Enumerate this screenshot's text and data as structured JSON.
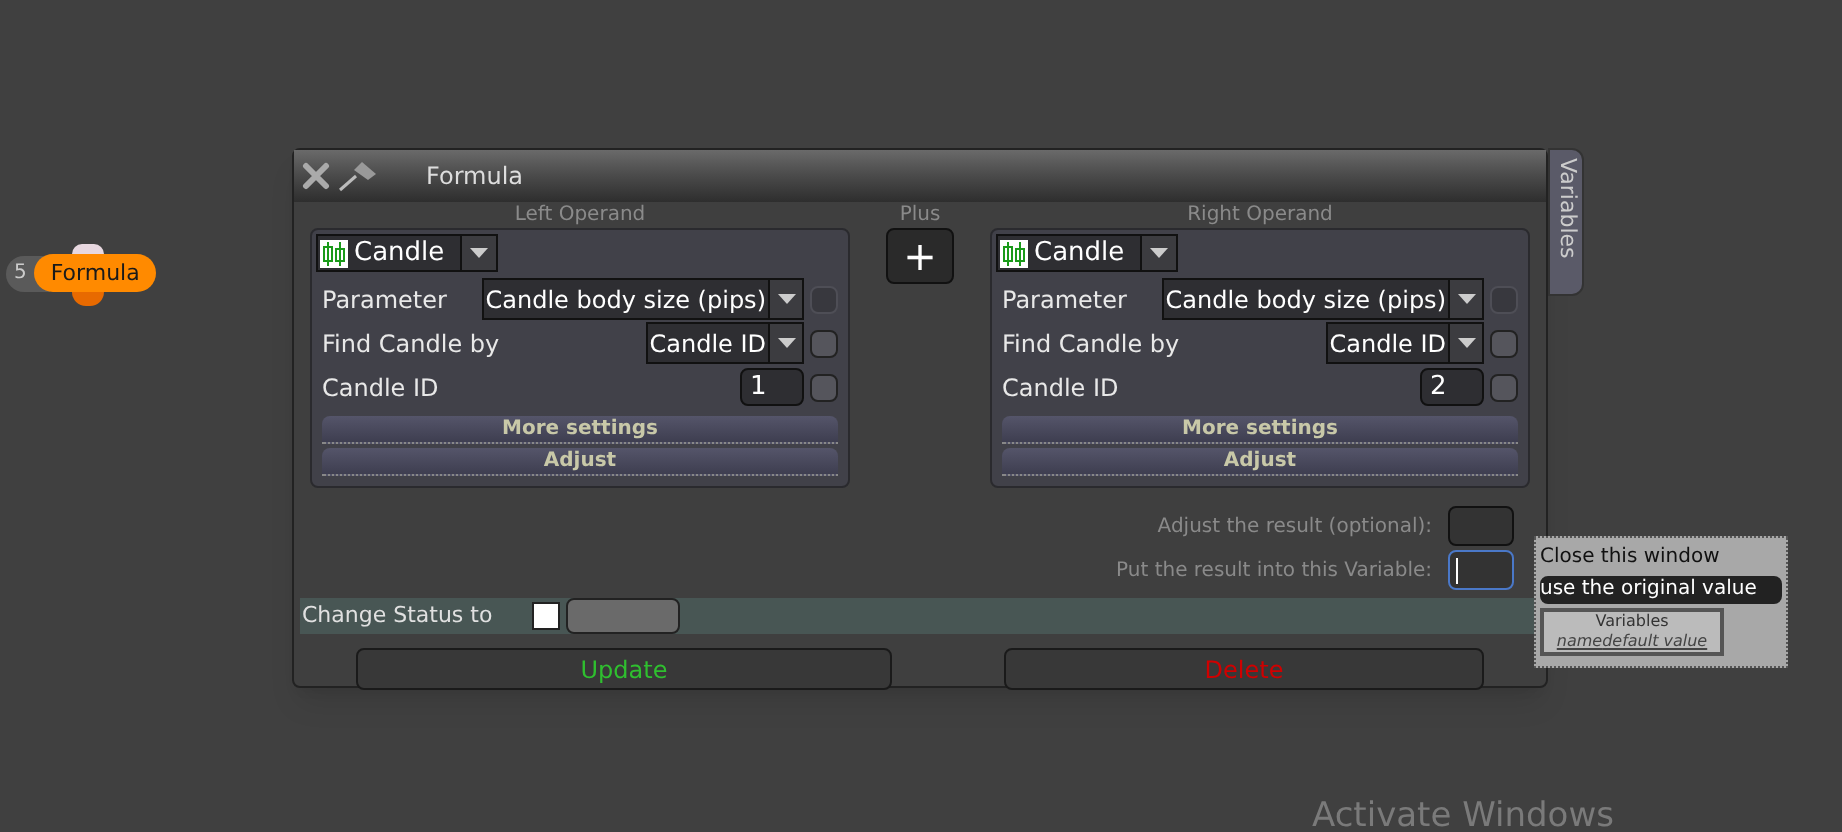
{
  "node": {
    "badge": "5",
    "label": "Formula"
  },
  "window": {
    "title": "Formula",
    "side_tab": "Variables"
  },
  "operands": [
    {
      "caption": "Left Operand",
      "type": "Candle",
      "rows": [
        {
          "kind": "select",
          "label": "Parameter",
          "value": "Candle body size (pips)",
          "checked": false,
          "disabled": true
        },
        {
          "kind": "select",
          "label": "Find Candle by",
          "value": "Candle ID",
          "checked": false,
          "disabled": false
        },
        {
          "kind": "input",
          "label": "Candle ID",
          "value": "1",
          "checked": false,
          "disabled": false
        }
      ],
      "buttons": [
        "More settings",
        "Adjust"
      ]
    },
    {
      "caption": "Right Operand",
      "type": "Candle",
      "rows": [
        {
          "kind": "select",
          "label": "Parameter",
          "value": "Candle body size (pips)",
          "checked": false,
          "disabled": true
        },
        {
          "kind": "select",
          "label": "Find Candle by",
          "value": "Candle ID",
          "checked": false,
          "disabled": false
        },
        {
          "kind": "input",
          "label": "Candle ID",
          "value": "2",
          "checked": false,
          "disabled": false
        }
      ],
      "buttons": [
        "More settings",
        "Adjust"
      ]
    }
  ],
  "operator": {
    "caption": "Plus",
    "symbol": "+"
  },
  "result_fields": [
    {
      "label": "Adjust the result (optional):",
      "focused": false
    },
    {
      "label": "Put the result into this Variable:",
      "focused": true
    }
  ],
  "status": {
    "label": "Change Status to",
    "checked": false
  },
  "actions": [
    {
      "label": "Update",
      "kind": "update"
    },
    {
      "label": "Delete",
      "kind": "delete"
    }
  ],
  "popup": {
    "items": [
      "Close this window",
      "use the original value"
    ],
    "variables_title": "Variables",
    "variables_columns": [
      "name",
      "default value"
    ]
  },
  "watermark": "Activate Windows"
}
